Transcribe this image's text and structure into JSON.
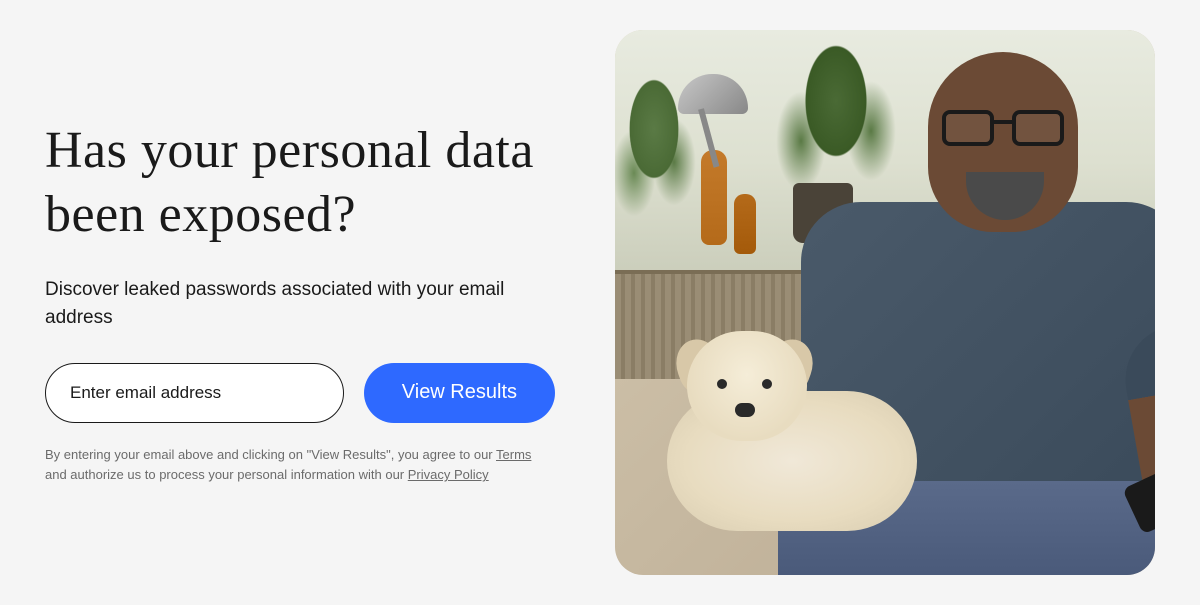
{
  "hero": {
    "headline": "Has your personal data been exposed?",
    "subhead": "Discover leaked passwords associated with your email address"
  },
  "form": {
    "email_placeholder": "Enter email address",
    "submit_label": "View Results"
  },
  "disclaimer": {
    "prefix": "By entering your email above and clicking on \"View Results\", you agree to our ",
    "terms_label": "Terms",
    "middle": " and authorize us to process your personal information with our ",
    "privacy_label": "Privacy Policy"
  },
  "image": {
    "alt": "Man with glasses sitting with a small dog on his lap, looking at his phone"
  }
}
